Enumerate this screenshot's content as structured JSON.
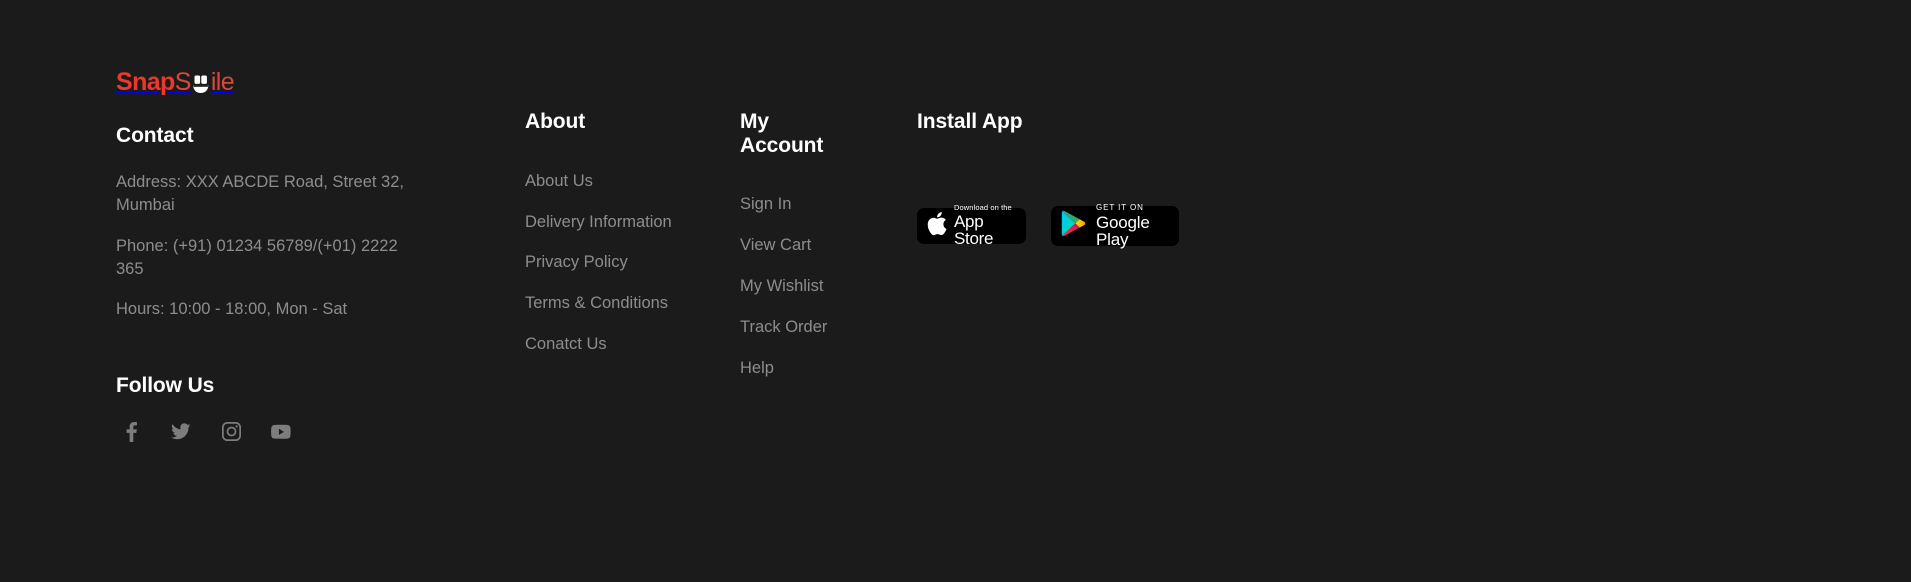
{
  "theme": {
    "background": "#1b1b1b",
    "heading_color": "#ffffff",
    "body_text_color": "#8d8d8d",
    "brand_red": "#e8392b",
    "badge_background": "#000000"
  },
  "brand": {
    "part1": "Snap",
    "part2": "S",
    "icon": "smile-teeth-icon",
    "part3": "ile",
    "full_text": "SnapSmile"
  },
  "contact": {
    "heading": "Contact",
    "lines": [
      "Address: XXX ABCDE Road, Street 32, Mumbai",
      "Phone: (+91) 01234 56789/(+01) 2222 365",
      "Hours: 10:00 - 18:00, Mon - Sat"
    ]
  },
  "follow": {
    "heading": "Follow Us",
    "socials": [
      {
        "name": "facebook",
        "icon": "facebook-icon"
      },
      {
        "name": "twitter",
        "icon": "twitter-icon"
      },
      {
        "name": "instagram",
        "icon": "instagram-icon"
      },
      {
        "name": "youtube",
        "icon": "youtube-icon"
      }
    ]
  },
  "about": {
    "heading": "About",
    "links": [
      "About Us",
      "Delivery Information",
      "Privacy Policy",
      "Terms & Conditions",
      "Conatct Us"
    ]
  },
  "account": {
    "heading": "My Account",
    "links": [
      "Sign In",
      "View Cart",
      "My Wishlist",
      "Track Order",
      "Help"
    ]
  },
  "install": {
    "heading": "Install App",
    "badges": [
      {
        "store": "apple-app-store",
        "small_text": "Download on the",
        "big_text": "App Store",
        "icon": "apple-logo-icon"
      },
      {
        "store": "google-play",
        "small_text": "GET IT ON",
        "big_text": "Google Play",
        "icon": "google-play-triangle-icon"
      }
    ]
  }
}
